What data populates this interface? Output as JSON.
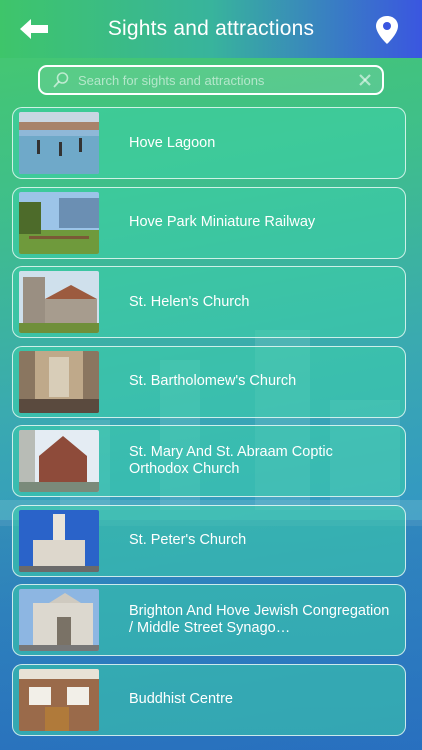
{
  "header": {
    "title": "Sights and attractions",
    "back_icon": "back-arrow-icon",
    "map_icon": "map-pin-icon"
  },
  "search": {
    "placeholder": "Search for sights and attractions",
    "value": ""
  },
  "items": [
    {
      "label": "Hove Lagoon"
    },
    {
      "label": "Hove Park Miniature Railway"
    },
    {
      "label": "St. Helen's Church"
    },
    {
      "label": "St. Bartholomew's Church"
    },
    {
      "label": "St. Mary And St. Abraam Coptic Orthodox Church"
    },
    {
      "label": "St. Peter's Church"
    },
    {
      "label": "Brighton And Hove Jewish Congregation / Middle Street Synago…"
    },
    {
      "label": "Buddhist Centre"
    }
  ],
  "colors": {
    "accent_green": "#3ec56a",
    "accent_blue": "#3a56e0",
    "row_fill": "#3cd2aa"
  }
}
